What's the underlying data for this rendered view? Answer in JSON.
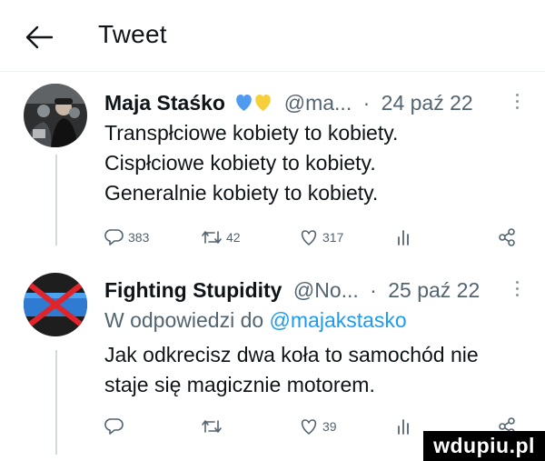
{
  "header": {
    "title": "Tweet"
  },
  "tweets": [
    {
      "author": "Maja Staśko",
      "handle": "@ma...",
      "separator": "·",
      "date": "24 paź 22",
      "text_lines": [
        "Transpłciowe kobiety to kobiety.",
        "Cispłciowe kobiety to kobiety.",
        "Generalnie kobiety to kobiety."
      ],
      "actions": {
        "replies": "383",
        "retweets": "42",
        "likes": "317"
      },
      "badge_icons": [
        "blue-heart-icon",
        "yellow-heart-icon"
      ]
    },
    {
      "author": "Fighting Stupidity",
      "handle": "@No...",
      "separator": "·",
      "date": "25 paź 22",
      "reply_prefix": "W odpowiedzi do",
      "reply_handle": "@majakstasko",
      "text_lines": [
        "Jak odkrecisz dwa koła to samochód nie",
        "staje się magicznie motorem."
      ],
      "actions": {
        "replies": "",
        "retweets": "",
        "likes": "39"
      }
    }
  ],
  "watermark": {
    "text": "wdupiu.pl"
  },
  "colors": {
    "text": "#0f1419",
    "secondary": "#536471",
    "link": "#1d9bf0",
    "divider": "#eff3f4",
    "thread_line": "#cfd9de"
  }
}
